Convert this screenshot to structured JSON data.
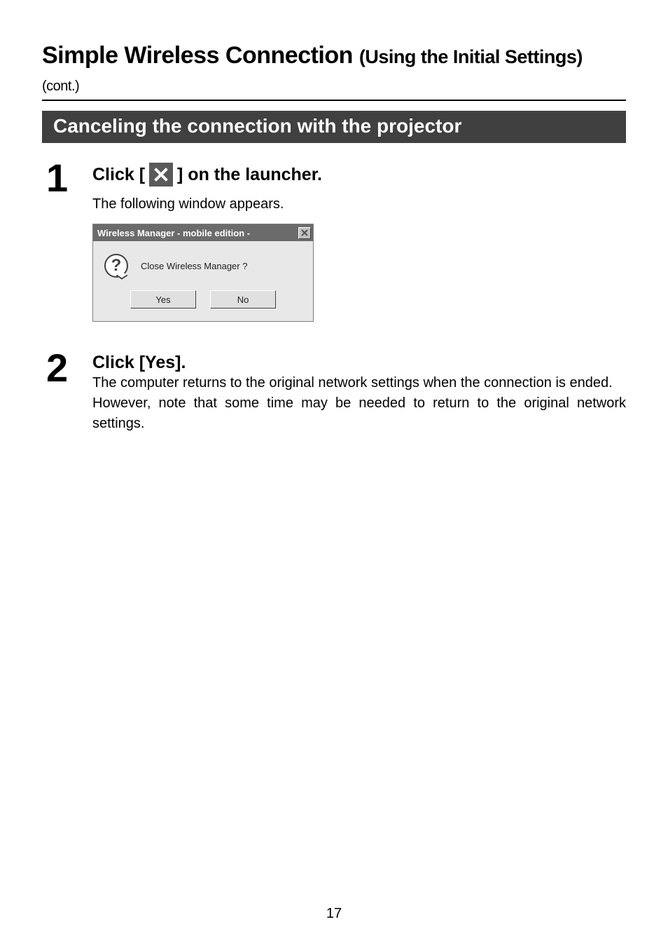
{
  "page": {
    "title_main": "Simple Wireless Connection",
    "title_sub": "(Using the Initial Settings)",
    "title_cont": "(cont.)",
    "page_number": "17"
  },
  "section": {
    "heading": "Canceling the connection with the projector"
  },
  "step1": {
    "number": "1",
    "instruction_prefix": "Click [",
    "instruction_suffix": "] on the launcher.",
    "icon_name": "close-x-icon",
    "subtext": "The following window appears."
  },
  "dialog": {
    "title": "Wireless Manager - mobile edition -",
    "message": "Close Wireless Manager ?",
    "yes_label": "Yes",
    "no_label": "No"
  },
  "step2": {
    "number": "2",
    "instruction": "Click [Yes].",
    "text1": "The computer returns to the original network settings when the connection is ended.",
    "text2": "However, note that some time may be needed to return to the original network settings."
  }
}
